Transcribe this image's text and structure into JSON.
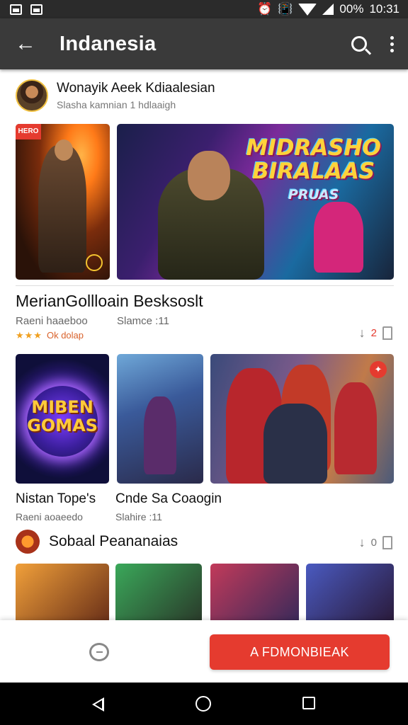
{
  "status_bar": {
    "battery": "00%",
    "time": "10:31"
  },
  "app_bar": {
    "title": "Indanesia"
  },
  "developer": {
    "name": "Wonayik Aeek  Kdiaalesian",
    "subtitle": "Slasha kamnian      1 hdlaaigh"
  },
  "media": {
    "hero_logo_line1": "MIDRASHO",
    "hero_logo_line2": "BIRALAAS",
    "hero_logo_line3": "PRUAS",
    "tile_badge": "HERO",
    "promo_tile_text_line1": "MIBEN",
    "promo_tile_text_line2": "GOMAS"
  },
  "app": {
    "title": "MerianGollloain Besksoslt",
    "meta_left": "Raeni haaeboo",
    "meta_right": "Slamce :11",
    "rating_text": "Ok dolap",
    "download_count": "2"
  },
  "row2": {
    "caption1": "Nistan Tope's",
    "caption1_sub": "Raeni aoaeedo",
    "caption2": "Cnde Sa Coaogin",
    "caption2_sub": "Slahire :11",
    "badge_glyph": "✦"
  },
  "section": {
    "label": "Sobaal Peananaias",
    "download_count": "0"
  },
  "bottom_bar": {
    "cta_label": "A FDMONBIEAK"
  },
  "icons": [
    "back-arrow-icon",
    "search-icon",
    "more-vert-icon",
    "download-icon",
    "bookmark-icon",
    "chat-icon"
  ]
}
